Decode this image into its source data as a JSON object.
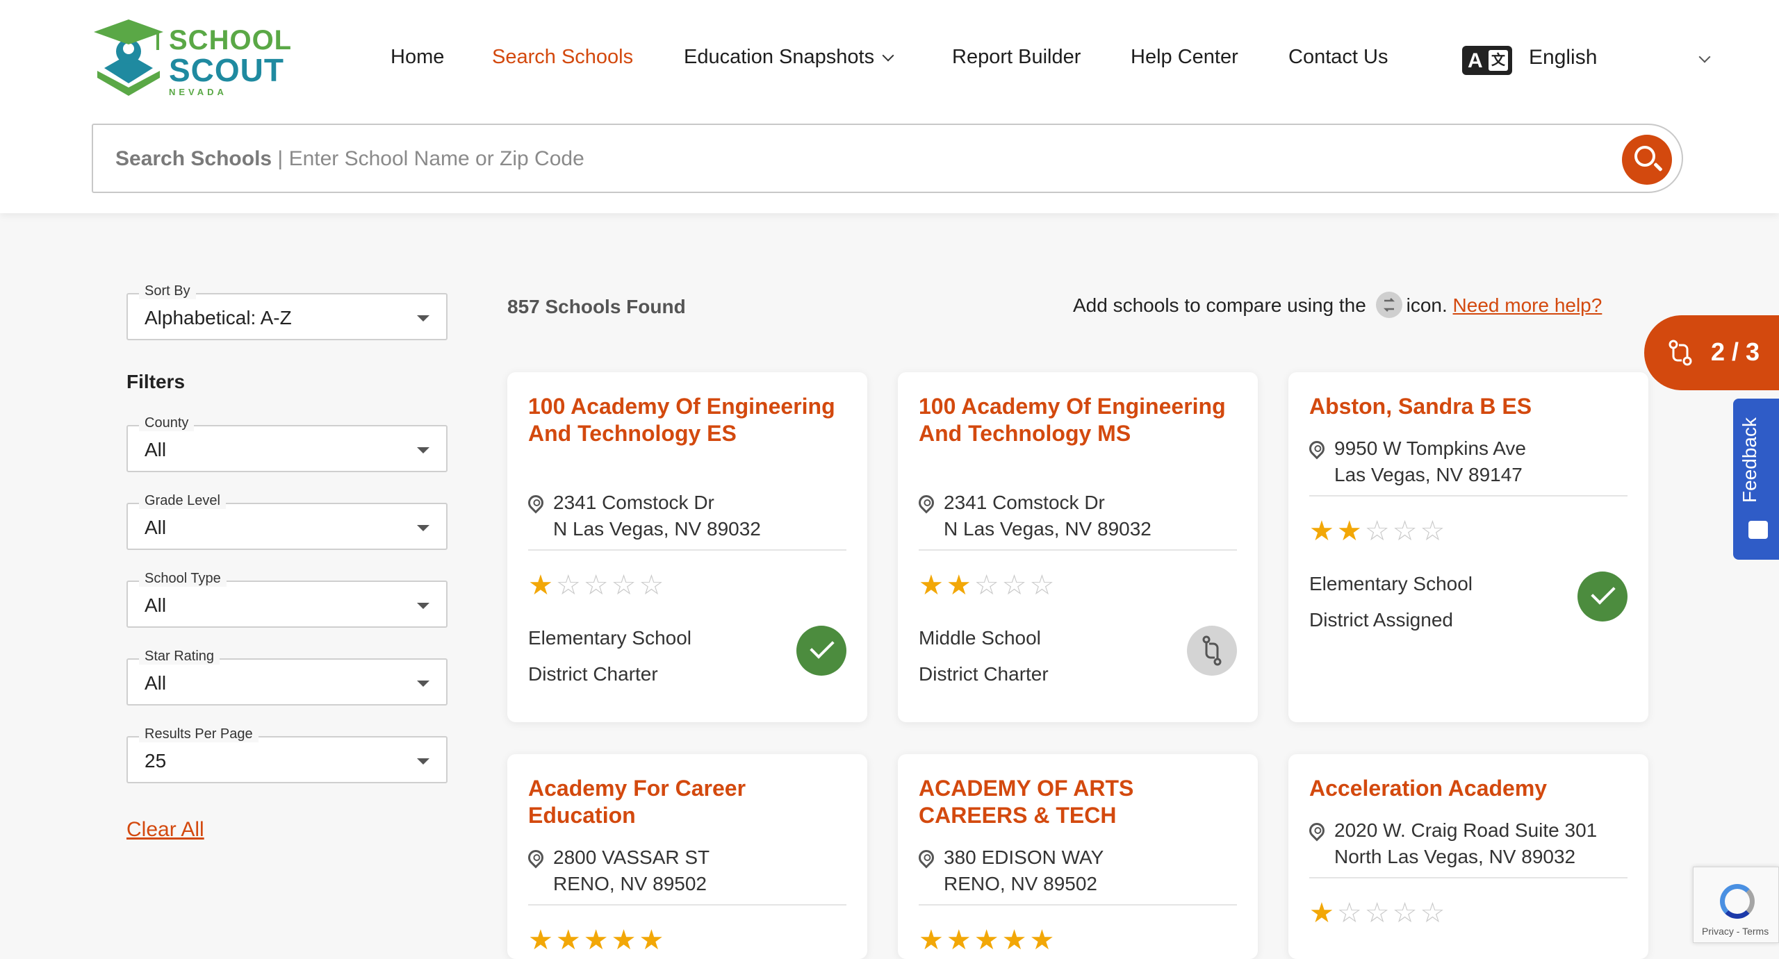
{
  "logo": {
    "line1": "SCHOOL",
    "line2": "SCOUT",
    "line3": "NEVADA"
  },
  "nav": {
    "home": "Home",
    "search_schools": "Search Schools",
    "education_snapshots": "Education Snapshots",
    "report_builder": "Report Builder",
    "help_center": "Help Center",
    "contact_us": "Contact Us",
    "language": "English"
  },
  "search": {
    "label": "Search Schools",
    "separator": " | ",
    "placeholder": "Enter School Name or Zip Code"
  },
  "sidebar": {
    "sort_by": {
      "label": "Sort By",
      "value": "Alphabetical: A-Z"
    },
    "filters_title": "Filters",
    "county": {
      "label": "County",
      "value": "All"
    },
    "grade_level": {
      "label": "Grade Level",
      "value": "All"
    },
    "school_type": {
      "label": "School Type",
      "value": "All"
    },
    "star_rating": {
      "label": "Star Rating",
      "value": "All"
    },
    "results_per_page": {
      "label": "Results Per Page",
      "value": "25"
    },
    "clear_all": "Clear All"
  },
  "results": {
    "count_text": "857 Schools Found",
    "compare_help_before": "Add schools to compare using the",
    "compare_help_after": "icon.",
    "need_help": "Need more help?"
  },
  "compare_pill": {
    "count": "2 / 3"
  },
  "feedback": {
    "label": "Feedback"
  },
  "recaptcha": {
    "text": "Privacy - Terms"
  },
  "schools": [
    {
      "name": "100 Academy Of Engineering And Technology ES",
      "addr1": "2341 Comstock Dr",
      "addr2": "N Las Vegas, NV 89032",
      "rating": 1,
      "level": "Elementary School",
      "type": "District Charter",
      "compared": true
    },
    {
      "name": "100 Academy Of Engineering And Technology MS",
      "addr1": "2341 Comstock Dr",
      "addr2": "N Las Vegas, NV 89032",
      "rating": 2,
      "level": "Middle School",
      "type": "District Charter",
      "compared": false
    },
    {
      "name": "Abston, Sandra B ES",
      "addr1": "9950 W Tompkins Ave",
      "addr2": "Las Vegas, NV 89147",
      "rating": 2,
      "level": "Elementary School",
      "type": "District Assigned",
      "compared": true
    },
    {
      "name": "Academy For Career Education",
      "addr1": "2800 VASSAR ST",
      "addr2": "RENO, NV 89502",
      "rating": 5
    },
    {
      "name": "ACADEMY OF ARTS CAREERS & TECH",
      "addr1": "380 EDISON WAY",
      "addr2": "RENO, NV 89502",
      "rating": 5
    },
    {
      "name": "Acceleration Academy",
      "addr1": "2020 W. Craig Road Suite 301",
      "addr2": "North Las Vegas, NV 89032",
      "rating": 1
    }
  ]
}
